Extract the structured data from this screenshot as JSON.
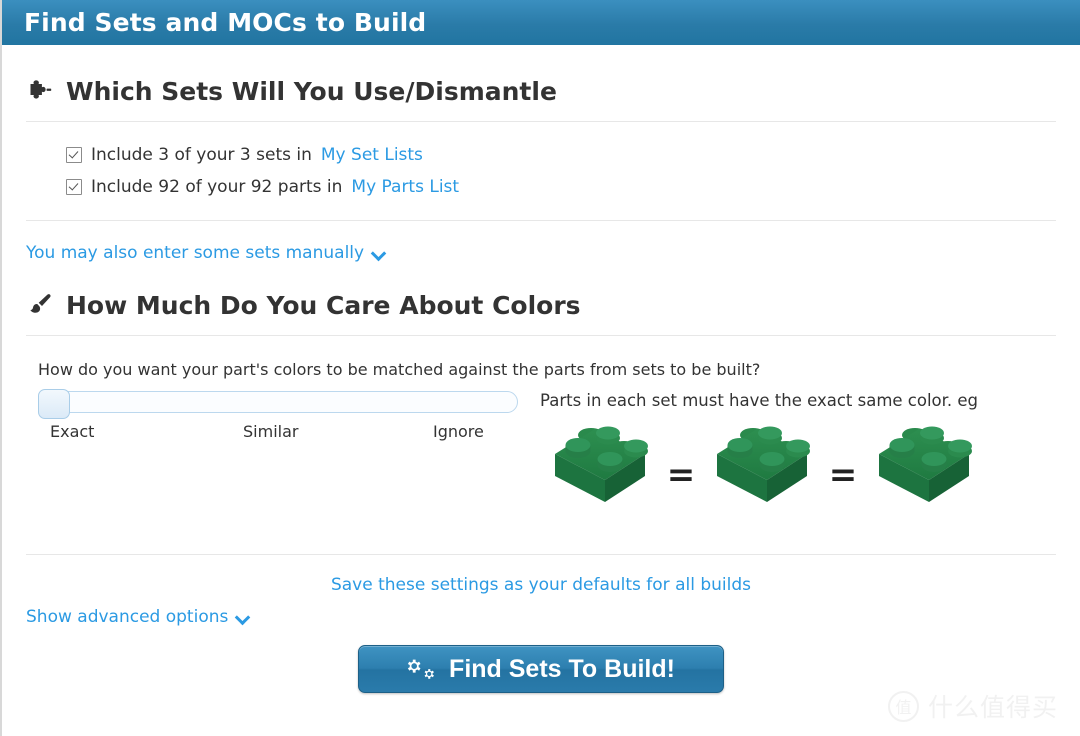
{
  "titlebar": {
    "title": "Find Sets and MOCs to Build",
    "background": "#2a7ba8"
  },
  "sections": {
    "sets": {
      "icon": "puzzle-piece-icon",
      "heading": "Which Sets Will You Use/Dismantle",
      "options": [
        {
          "checked": true,
          "text_before": "Include 3 of your 3 sets in",
          "link_label": "My Set Lists"
        },
        {
          "checked": true,
          "text_before": "Include 92 of your 92 parts in",
          "link_label": "My Parts List"
        }
      ],
      "manual_toggle_label": "You may also enter some sets manually",
      "manual_toggle_icon": "chevron-down-icon"
    },
    "colors": {
      "icon": "paintbrush-icon",
      "heading": "How Much Do You Care About Colors",
      "question": "How do you want your part's colors to be matched against the parts from sets to be built?",
      "slider": {
        "value": "Exact",
        "position_percent": 0,
        "labels": [
          "Exact",
          "Similar",
          "Ignore"
        ]
      },
      "example_text": "Parts in each set must have the exact same color. eg",
      "example_bricks": [
        {
          "name": "green-2x2-brick",
          "color": "#1e7a43"
        },
        {
          "name": "green-2x2-brick",
          "color": "#1e7a43"
        },
        {
          "name": "green-2x2-brick",
          "color": "#1e7a43"
        }
      ],
      "equals_symbol": "="
    }
  },
  "footer": {
    "save_defaults_label": "Save these settings as your defaults for all builds",
    "advanced_toggle_label": "Show advanced options",
    "advanced_toggle_icon": "chevron-down-icon",
    "cta_label": "Find Sets To Build!",
    "cta_icon": "cogs-icon",
    "cta_color": "#2a7ba8"
  },
  "watermark": {
    "badge": "值",
    "text": "什么值得买"
  },
  "colors": {
    "link": "#2b9ae3",
    "text": "#333333",
    "divider": "#e7e7e7"
  }
}
